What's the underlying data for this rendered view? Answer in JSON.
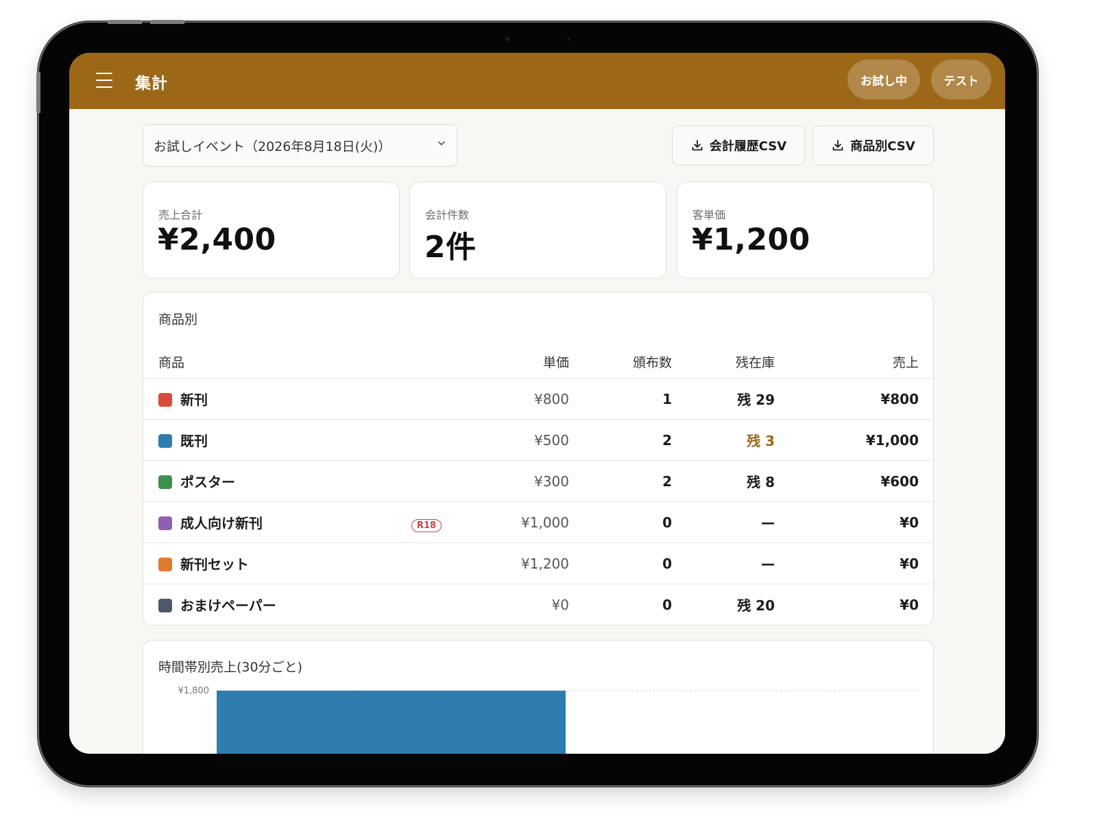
{
  "appbar": {
    "title": "集計",
    "trial_label": "お試し中",
    "test_label": "テスト"
  },
  "event_selector": {
    "value": "お試しイベント（2026年8月18日(火)）"
  },
  "csv": {
    "history_label": "会計履歴CSV",
    "product_label": "商品別CSV"
  },
  "stats": [
    {
      "label": "売上合計",
      "value": "¥2,400"
    },
    {
      "label": "会計件数",
      "value": "2件"
    },
    {
      "label": "客単価",
      "value": "¥1,200"
    }
  ],
  "products": {
    "title": "商品別",
    "headers": {
      "name": "商品",
      "price": "単価",
      "distributed": "頒布数",
      "stock": "残在庫",
      "sales": "売上"
    },
    "rows": [
      {
        "name": "新刊",
        "color": "#d94b3b",
        "price": "¥800",
        "distributed": "1",
        "stock": "残 29",
        "sales": "¥800",
        "badge": "",
        "low_stock": false
      },
      {
        "name": "既刊",
        "color": "#2f7db0",
        "price": "¥500",
        "distributed": "2",
        "stock": "残 3",
        "sales": "¥1,000",
        "badge": "",
        "low_stock": true
      },
      {
        "name": "ポスター",
        "color": "#3d9150",
        "price": "¥300",
        "distributed": "2",
        "stock": "残 8",
        "sales": "¥600",
        "badge": "",
        "low_stock": false
      },
      {
        "name": "成人向け新刊",
        "color": "#8f5fb5",
        "price": "¥1,000",
        "distributed": "0",
        "stock": "—",
        "sales": "¥0",
        "badge": "R18",
        "low_stock": false
      },
      {
        "name": "新刊セット",
        "color": "#e07b2e",
        "price": "¥1,200",
        "distributed": "0",
        "stock": "—",
        "sales": "¥0",
        "badge": "",
        "low_stock": false
      },
      {
        "name": "おまけペーパー",
        "color": "#4f5868",
        "price": "¥0",
        "distributed": "0",
        "stock": "残 20",
        "sales": "¥0",
        "badge": "",
        "low_stock": false
      }
    ]
  },
  "accent_color": "#9c6717",
  "chart_data": {
    "type": "bar",
    "title": "時間帯別売上(30分ごと)",
    "ytick_labels": [
      "¥1,800"
    ],
    "ymax": 1800,
    "series": [
      {
        "values": [
          1800
        ],
        "color": "#2f7db0"
      }
    ]
  }
}
